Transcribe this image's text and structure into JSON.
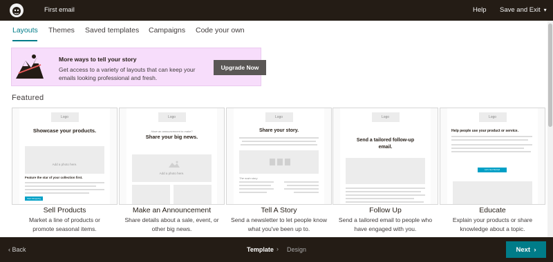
{
  "header": {
    "title": "First email",
    "help": "Help",
    "save_exit": "Save and Exit"
  },
  "tabs": [
    {
      "label": "Layouts",
      "active": true
    },
    {
      "label": "Themes",
      "active": false
    },
    {
      "label": "Saved templates",
      "active": false
    },
    {
      "label": "Campaigns",
      "active": false
    },
    {
      "label": "Code your own",
      "active": false
    }
  ],
  "promo": {
    "title": "More ways to tell your story",
    "description": "Get access to a variety of layouts that can keep your emails looking professional and fresh.",
    "button": "Upgrade Now"
  },
  "section_title": "Featured",
  "templates": [
    {
      "name": "Sell Products",
      "description": "Market a line of products or promote seasonal items.",
      "preview": {
        "logo": "Logo",
        "heading": "Showcase your products.",
        "photo": "Add a photo here.",
        "subheading": "Feature the star of your collection first.",
        "button": "Start Shopping"
      }
    },
    {
      "name": "Make an Announcement",
      "description": "Share details about a sale, event, or other big news.",
      "preview": {
        "logo": "Logo",
        "kicker": "Have an announcement to make?",
        "heading": "Share your big news.",
        "photo": "Add a photo here."
      }
    },
    {
      "name": "Tell A Story",
      "description": "Send a newsletter to let people know what you've been up to.",
      "preview": {
        "logo": "Logo",
        "heading": "Share your story.",
        "subheading": "The main story"
      }
    },
    {
      "name": "Follow Up",
      "description": "Send a tailored email to people who have engaged with you.",
      "preview": {
        "logo": "Logo",
        "heading": "Send a tailored follow-up email."
      }
    },
    {
      "name": "Educate",
      "description": "Explain your products or share knowledge about a topic.",
      "preview": {
        "logo": "Logo",
        "heading": "Help people use your product or service.",
        "button": "Let's Get Started"
      }
    }
  ],
  "footer": {
    "back": "Back",
    "step_template": "Template",
    "step_design": "Design",
    "next": "Next"
  },
  "colors": {
    "header_bg": "#241c15",
    "accent": "#007c89",
    "promo_bg": "#f7ddfb",
    "upgrade_bg": "#5a5755",
    "preview_button": "#00a0c6"
  },
  "icons": [
    "mailchimp-logo-icon",
    "chevron-down-icon",
    "chevron-left-icon",
    "chevron-right-icon",
    "promo-illustration-icon",
    "image-placeholder-icon"
  ]
}
